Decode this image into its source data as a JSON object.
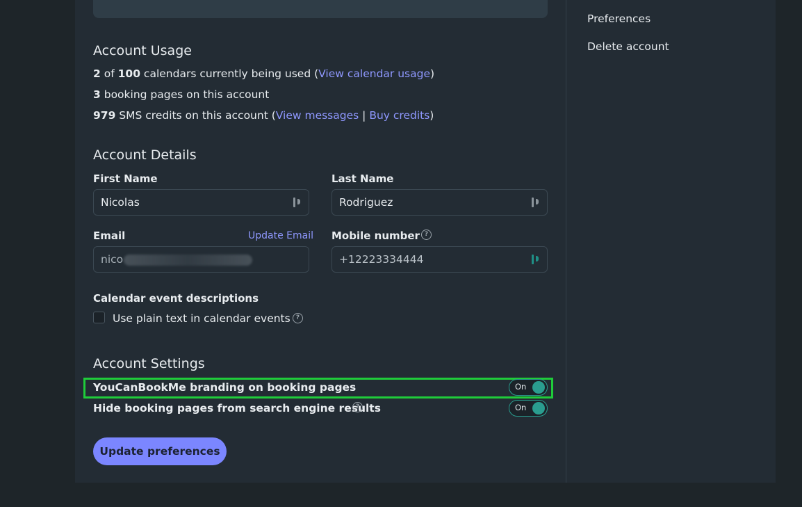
{
  "usage": {
    "title": "Account Usage",
    "calendars_used": "2",
    "calendars_of": "of",
    "calendars_total": "100",
    "calendars_text": "calendars currently being used (",
    "view_calendar_usage": "View calendar usage",
    "close_paren": ")",
    "booking_pages_count": "3",
    "booking_pages_text": "booking pages on this account",
    "sms_credits": "979",
    "sms_text": "SMS credits on this account (",
    "view_messages": "View messages",
    "separator": "|",
    "buy_credits": "Buy credits"
  },
  "details": {
    "title": "Account Details",
    "first_name_label": "First Name",
    "first_name_value": "Nicolas",
    "last_name_label": "Last Name",
    "last_name_value": "Rodriguez",
    "email_label": "Email",
    "update_email": "Update Email",
    "email_value_visible": "nico",
    "mobile_label": "Mobile number",
    "mobile_value": "+12223334444",
    "calendar_desc_label": "Calendar event descriptions",
    "plain_text_label": "Use plain text in calendar events"
  },
  "settings": {
    "title": "Account Settings",
    "branding_label": "YouCanBookMe branding on booking pages",
    "branding_toggle": "On",
    "hide_label": "Hide booking pages from search engine results",
    "hide_toggle": "On",
    "update_button": "Update preferences"
  },
  "sidebar": {
    "items": [
      {
        "label": "Preferences"
      },
      {
        "label": "Delete account"
      }
    ]
  },
  "colors": {
    "accent": "#7b86ff",
    "link": "#8f98ff",
    "toggle_on": "#2a9d8f",
    "highlight": "#1fcc3a"
  }
}
